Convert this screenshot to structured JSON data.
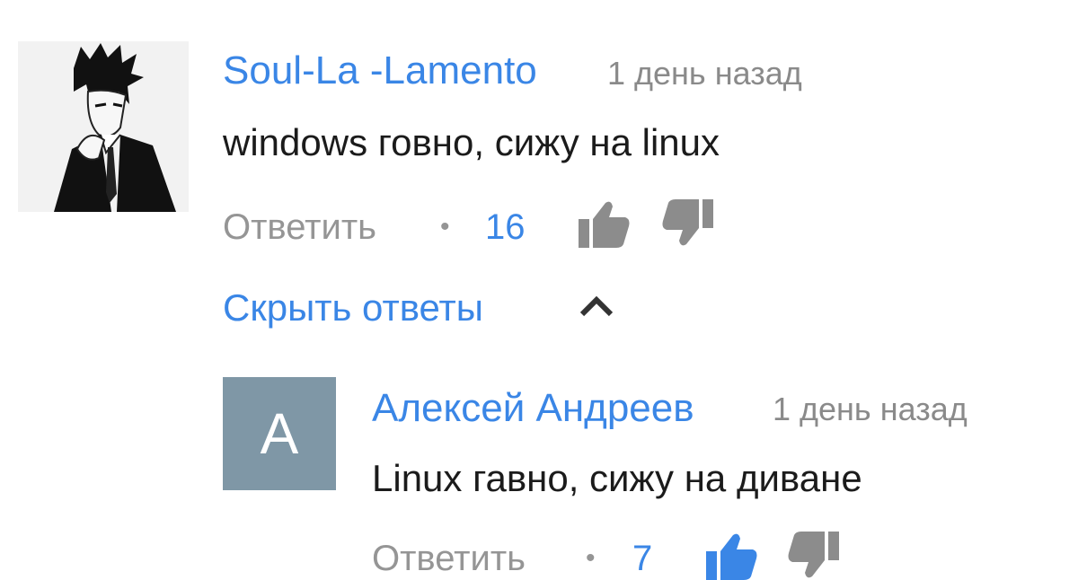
{
  "comments": [
    {
      "author": "Soul-La -Lamento",
      "time": "1 день назад",
      "text": "windows говно, сижу на linux",
      "reply_label": "Ответить",
      "separator": "•",
      "likes": "16"
    }
  ],
  "toggle_replies": {
    "label": "Скрыть ответы",
    "icon": "chevron-up-icon"
  },
  "replies": [
    {
      "avatar_letter": "A",
      "author": "Алексей Андреев",
      "time": "1 день назад",
      "text": "Linux гавно, сижу на диване",
      "reply_label": "Ответить",
      "separator": "•",
      "likes": "7"
    }
  ],
  "colors": {
    "link": "#3a86e6",
    "muted": "#8a8a8a",
    "text": "#1b1b1b",
    "letter_avatar_bg": "#7f97a6",
    "icon_gray": "#8c8c8c",
    "icon_blue": "#3a86e6"
  },
  "icons": [
    "thumbs-up-icon",
    "thumbs-down-icon",
    "chevron-up-icon"
  ]
}
